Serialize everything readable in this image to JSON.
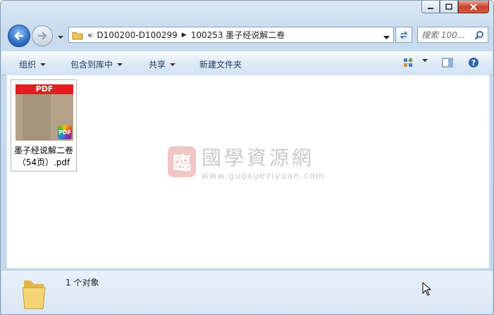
{
  "address": {
    "chevron": "«",
    "segments": [
      "D100200-D100299",
      "100253 墨子经说解二卷"
    ]
  },
  "search": {
    "placeholder": "搜索 100..."
  },
  "toolbar": {
    "organize": "组织",
    "include_library": "包含到库中",
    "share": "共享",
    "new_folder": "新建文件夹"
  },
  "files": [
    {
      "thumb_label": "PDF",
      "badge": "PDF",
      "name_line1": "墨子经说解二卷",
      "name_line2": "（54页）.pdf"
    }
  ],
  "watermark": {
    "seal": "臨",
    "name": "國學資源網",
    "url": "www.guoxueziyuan.com"
  },
  "details": {
    "count": "1 个对象"
  },
  "colors": {
    "accent": "#2f6fc4",
    "pdf_red": "#e01f22",
    "close_red": "#c7442e"
  }
}
